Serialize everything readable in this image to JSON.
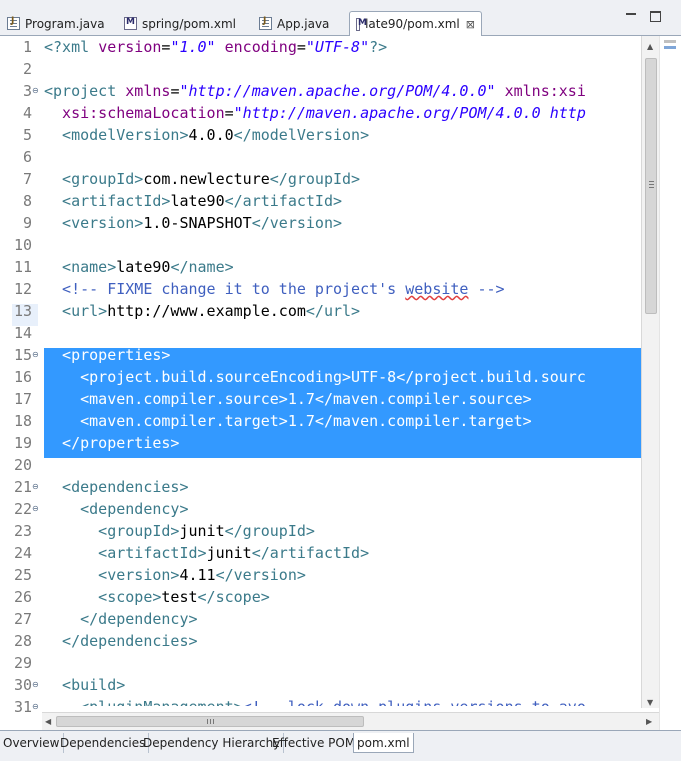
{
  "tabs": [
    {
      "label": "Program.java",
      "icon": "java-file-icon"
    },
    {
      "label": "spring/pom.xml",
      "icon": "maven-file-icon"
    },
    {
      "label": "App.java",
      "icon": "java-file-icon"
    },
    {
      "label": "late90/pom.xml",
      "icon": "maven-file-icon",
      "active": true,
      "close": "⊠"
    }
  ],
  "line_numbers": [
    "1",
    "2",
    "3",
    "4",
    "5",
    "6",
    "7",
    "8",
    "9",
    "10",
    "11",
    "12",
    "13",
    "14",
    "15",
    "16",
    "17",
    "18",
    "19",
    "20",
    "21",
    "22",
    "23",
    "24",
    "25",
    "26",
    "27",
    "28",
    "29",
    "30",
    "31"
  ],
  "code": {
    "l1": {
      "p1": "<?xml ",
      "p2": "version",
      "p3": "=",
      "p4": "\"1.0\"",
      "p5": " encoding",
      "p6": "=",
      "p7": "\"UTF-8\"",
      "p8": "?>"
    },
    "l3": {
      "p1": "<project ",
      "p2": "xmlns",
      "p3": "=",
      "p4": "\"http://maven.apache.org/POM/4.0.0\"",
      "p5": " xmlns:xsi"
    },
    "l4": {
      "p1": "  xsi:schemaLocation",
      "p2": "=",
      "p3": "\"http://maven.apache.org/POM/4.0.0 http"
    },
    "l5": {
      "p1": "  <modelVersion>",
      "p2": "4.0.0",
      "p3": "</modelVersion>"
    },
    "l7": {
      "p1": "  <groupId>",
      "p2": "com.newlecture",
      "p3": "</groupId>"
    },
    "l8": {
      "p1": "  <artifactId>",
      "p2": "late90",
      "p3": "</artifactId>"
    },
    "l9": {
      "p1": "  <version>",
      "p2": "1.0-SNAPSHOT",
      "p3": "</version>"
    },
    "l11": {
      "p1": "  <name>",
      "p2": "late90",
      "p3": "</name>"
    },
    "l12": {
      "p1": "  <!-- FIXME change it to the project's ",
      "p2": "website",
      "p3": " -->"
    },
    "l13": {
      "p1": "  <url>",
      "p2": "http://www.example.com",
      "p3": "</url>"
    },
    "l15": "  <properties>",
    "l16": "    <project.build.sourceEncoding>UTF-8</project.build.sourc",
    "l17": "    <maven.compiler.source>1.7</maven.compiler.source>",
    "l18": "    <maven.compiler.target>1.7</maven.compiler.target>",
    "l19": "  </properties>",
    "l21": "  <dependencies>",
    "l22": "    <dependency>",
    "l23": {
      "p1": "      <groupId>",
      "p2": "junit",
      "p3": "</groupId>"
    },
    "l24": {
      "p1": "      <artifactId>",
      "p2": "junit",
      "p3": "</artifactId>"
    },
    "l25": {
      "p1": "      <version>",
      "p2": "4.11",
      "p3": "</version>"
    },
    "l26": {
      "p1": "      <scope>",
      "p2": "test",
      "p3": "</scope>"
    },
    "l27": "    </dependency>",
    "l28": "  </dependencies>",
    "l30": "  <build>",
    "l31": {
      "p1": "    <pluginManagement>",
      "p2": "<!-- lock down plugins versions to avo"
    }
  },
  "bottom_tabs": [
    "Overview",
    "Dependencies",
    "Dependency Hierarchy",
    "Effective POM",
    "pom.xml"
  ],
  "active_bottom_tab": "pom.xml",
  "colors": {
    "selection": "#3399ff",
    "tag": "#3b7a8a",
    "attribute": "#7f007f",
    "string": "#2a00ff",
    "comment": "#3f5fbf"
  }
}
